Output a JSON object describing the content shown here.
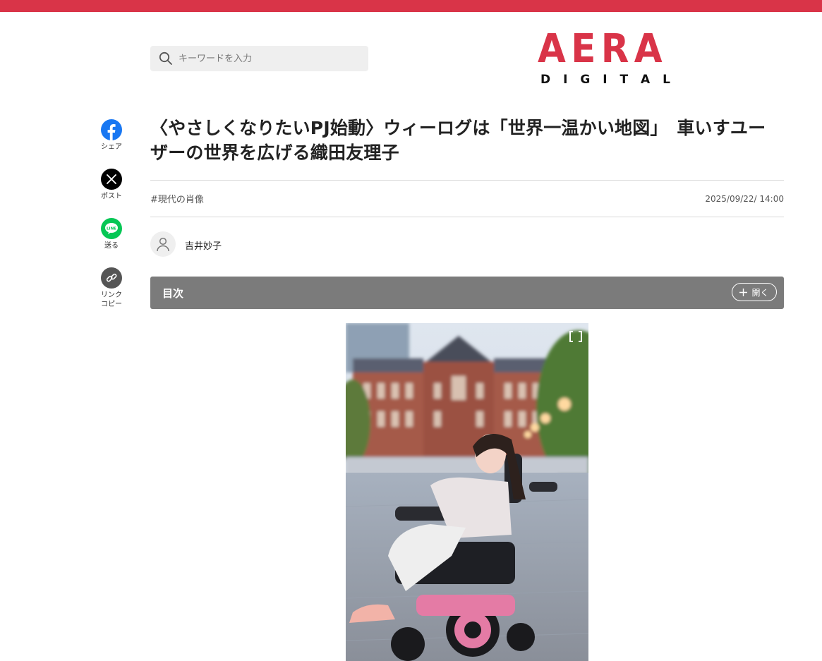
{
  "brand": {
    "primary_color": "#d93448",
    "logo_main": "AERA",
    "logo_sub": "DIGITAL"
  },
  "search": {
    "placeholder": "キーワードを入力",
    "icon": "search-icon"
  },
  "share": [
    {
      "label": "シェア",
      "icon": "facebook-icon",
      "color": "#1877f2"
    },
    {
      "label": "ポスト",
      "icon": "x-icon",
      "color": "#000000"
    },
    {
      "label": "送る",
      "icon": "line-icon",
      "color": "#06c755"
    },
    {
      "label": "リンク\nコピー",
      "icon": "link-icon",
      "color": "#555555"
    }
  ],
  "article": {
    "title": "〈やさしくなりたいPJ始動〉ウィーログは「世界一温かい地図」　車いすユーザーの世界を広げる織田友理子",
    "tag": "#現代の肖像",
    "date": "2025/09/22/ 14:00",
    "author": "吉井妙子"
  },
  "toc": {
    "title": "目次",
    "open_label": "開く",
    "background": "#7b7b7b"
  },
  "photo": {
    "icon": "expand-icon"
  }
}
